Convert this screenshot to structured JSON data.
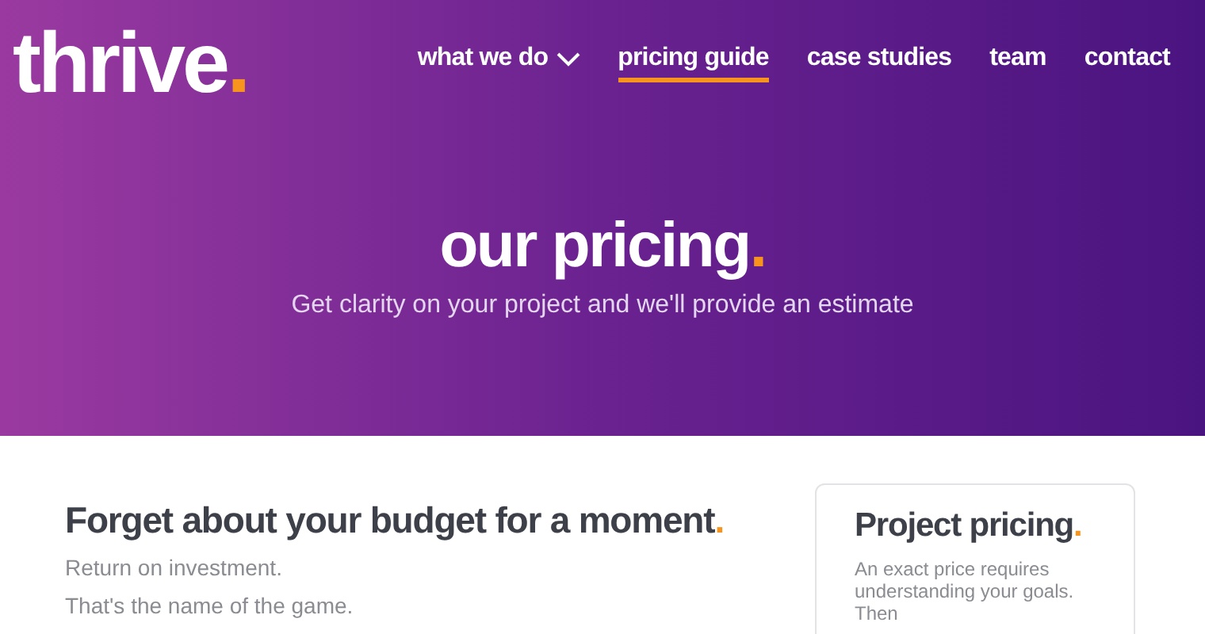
{
  "logo": {
    "text": "thrive",
    "accent": "."
  },
  "nav": [
    {
      "label": "what we do",
      "dropdown": true,
      "selected": false
    },
    {
      "label": "pricing guide",
      "dropdown": false,
      "selected": true
    },
    {
      "label": "case studies",
      "dropdown": false,
      "selected": false
    },
    {
      "label": "team",
      "dropdown": false,
      "selected": false
    },
    {
      "label": "contact",
      "dropdown": false,
      "selected": false
    }
  ],
  "hero": {
    "title": "our pricing",
    "accent": ".",
    "subtitle": "Get clarity on your project and we'll provide an estimate"
  },
  "main": {
    "heading": "Forget about your budget for a moment",
    "accent": ".",
    "paragraphs": [
      "Return on investment.",
      "That's the name of the game."
    ]
  },
  "card": {
    "heading": "Project pricing",
    "accent": ".",
    "text": "An exact price requires understanding your goals. Then"
  }
}
